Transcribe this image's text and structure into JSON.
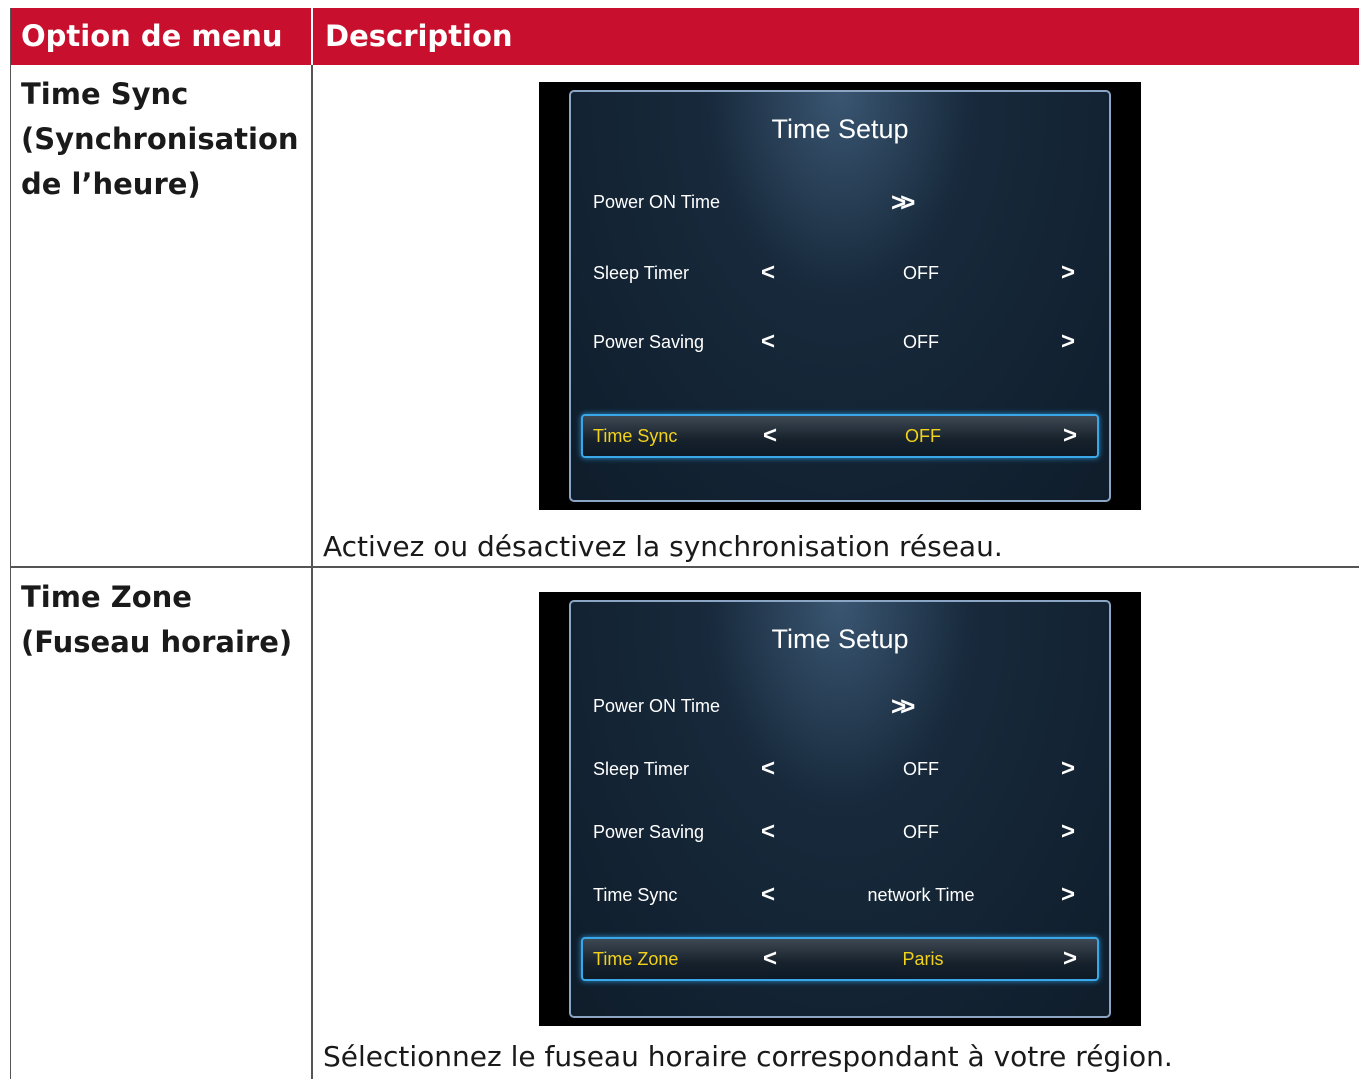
{
  "header": {
    "col_option": "Option de menu",
    "col_description": "Description"
  },
  "rows": [
    {
      "option_lines": [
        "Time Sync",
        "(Synchronisation",
        "de l’heure)"
      ],
      "screen": {
        "title": "Time Setup",
        "power_on_label": "Power ON Time",
        "items": [
          {
            "label": "Sleep Timer",
            "value": "OFF"
          },
          {
            "label": "Power Saving",
            "value": "OFF"
          }
        ],
        "selected": {
          "label": "Time Sync",
          "value": "OFF"
        }
      },
      "description": "Activez ou désactivez la synchronisation réseau."
    },
    {
      "option_lines": [
        "Time Zone",
        "(Fuseau horaire)"
      ],
      "screen": {
        "title": "Time Setup",
        "power_on_label": "Power ON Time",
        "items": [
          {
            "label": "Sleep Timer",
            "value": "OFF"
          },
          {
            "label": "Power Saving",
            "value": "OFF"
          },
          {
            "label": "Time Sync",
            "value": "network Time"
          }
        ],
        "selected": {
          "label": "Time Zone",
          "value": "Paris"
        }
      },
      "description": "Sélectionnez le fuseau horaire correspondant à votre région."
    }
  ],
  "glyphs": {
    "left_arrow": "<",
    "right_arrow": ">",
    "double_arrow": ">>"
  }
}
